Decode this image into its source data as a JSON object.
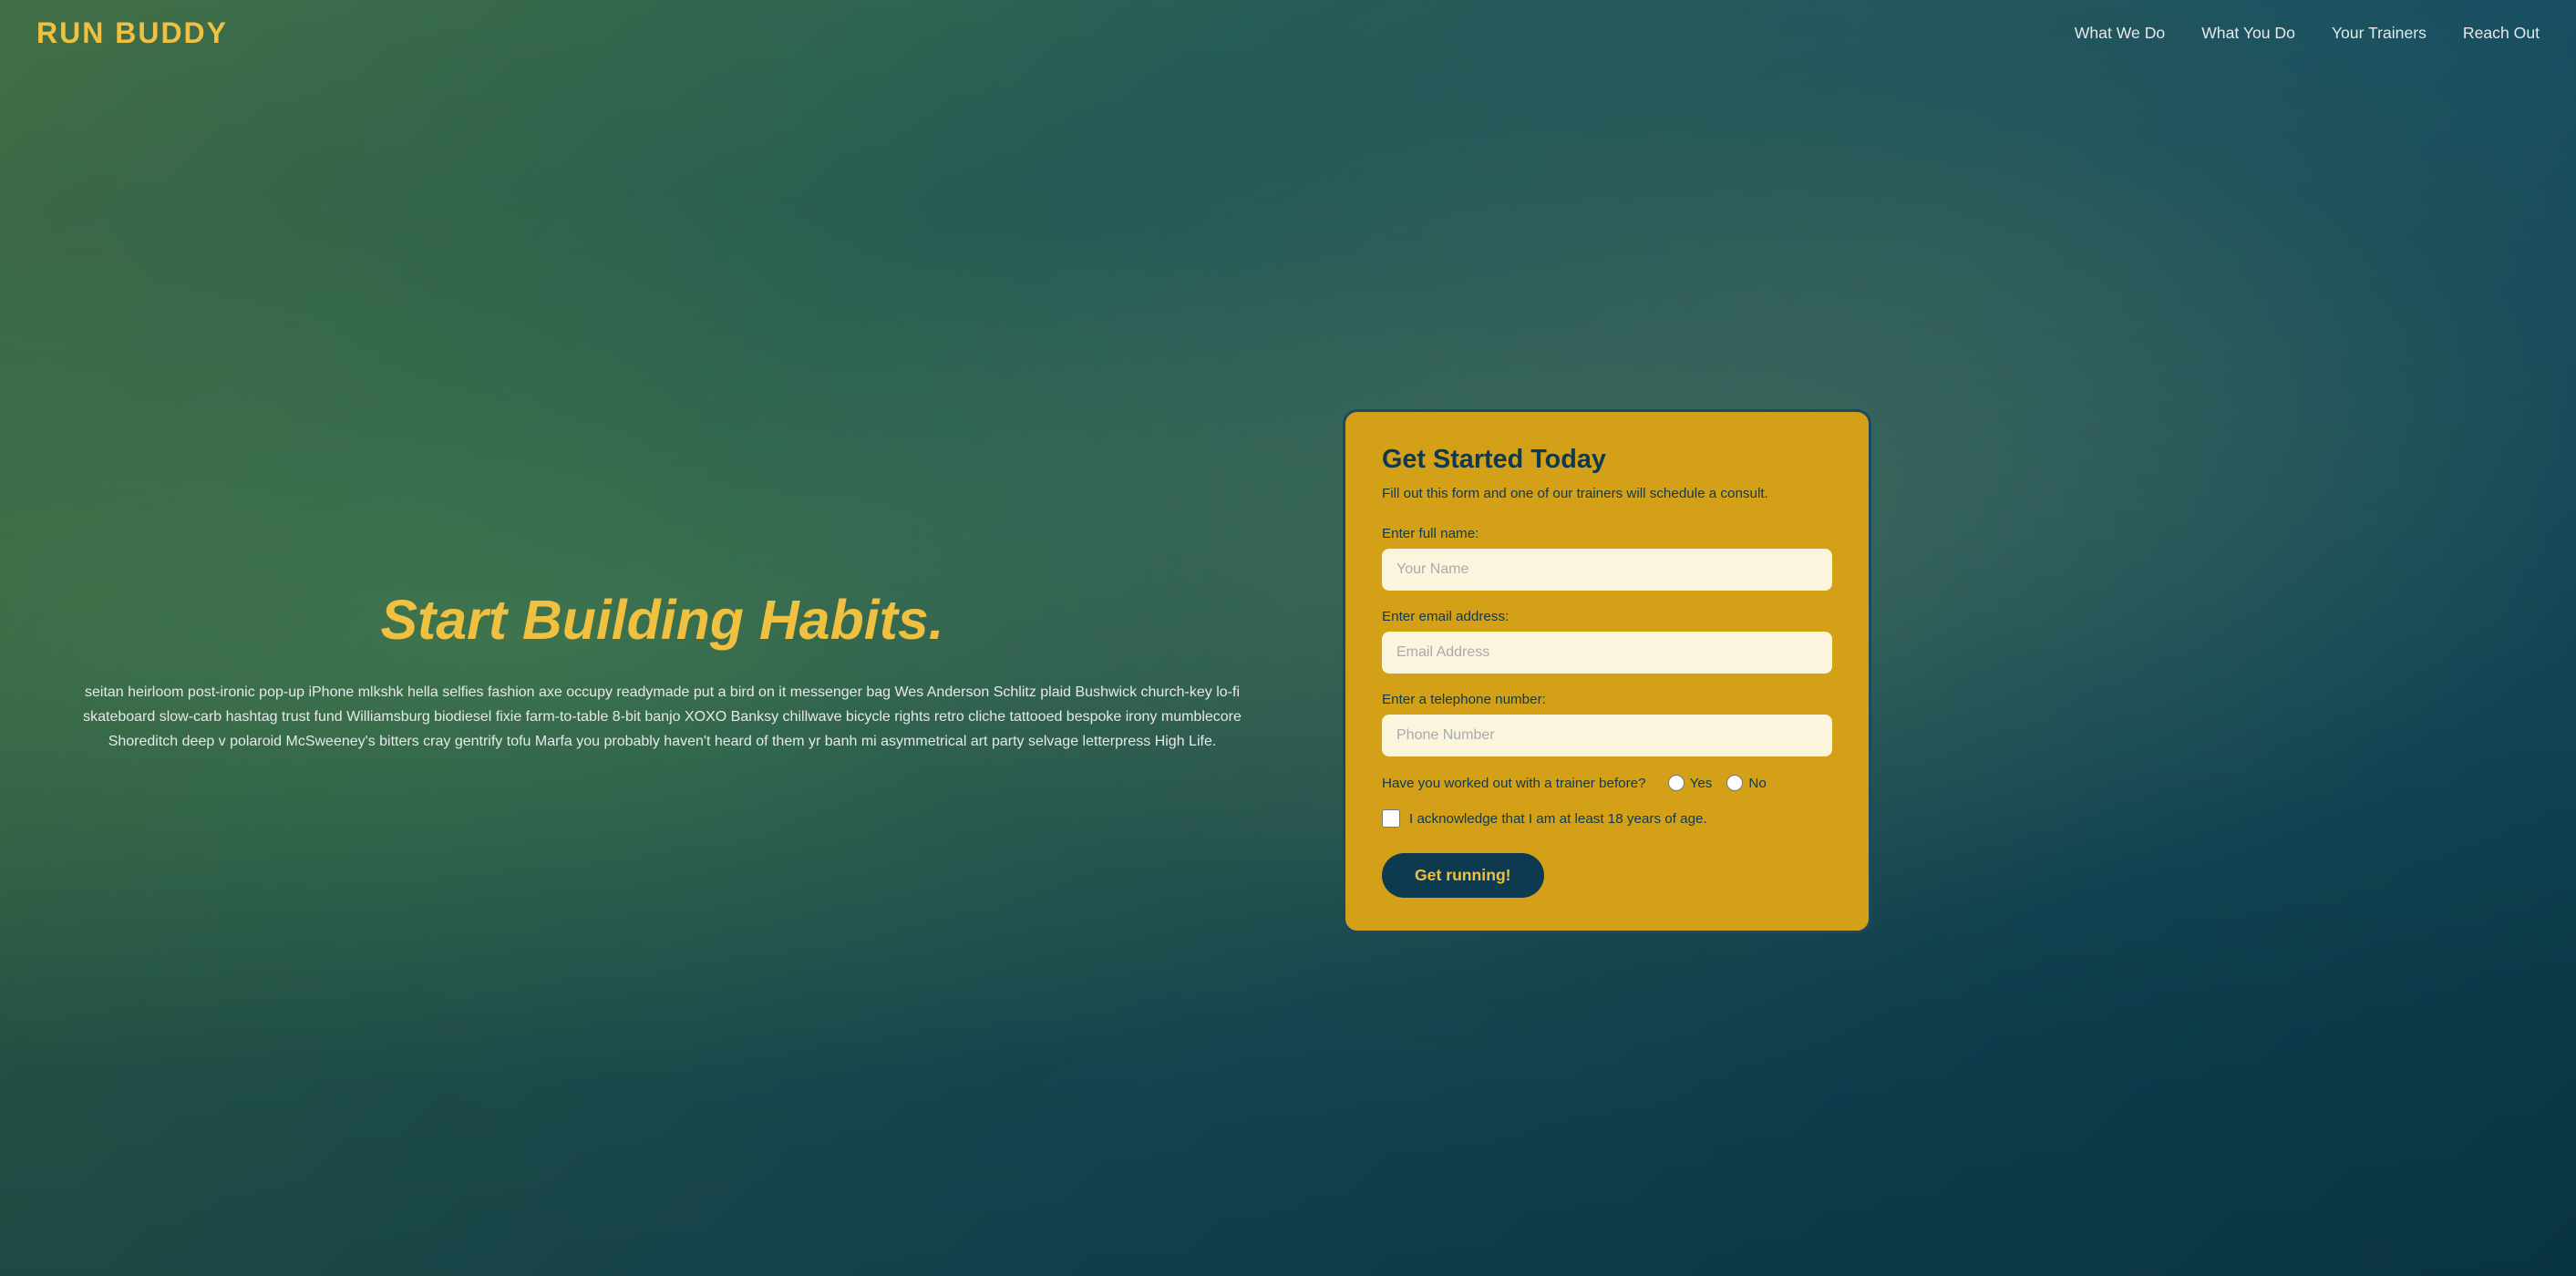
{
  "nav": {
    "logo": "RUN BUDDY",
    "links": [
      {
        "label": "What We Do",
        "href": "#what-we-do"
      },
      {
        "label": "What You Do",
        "href": "#what-you-do"
      },
      {
        "label": "Your Trainers",
        "href": "#your-trainers"
      },
      {
        "label": "Reach Out",
        "href": "#reach-out"
      }
    ]
  },
  "hero": {
    "headline": "Start Building Habits.",
    "body": "seitan heirloom post-ironic pop-up iPhone mlkshk hella selfies fashion axe occupy readymade put a bird on it messenger bag Wes Anderson Schlitz plaid Bushwick church-key lo-fi skateboard slow-carb hashtag trust fund Williamsburg biodiesel fixie farm-to-table 8-bit banjo XOXO Banksy chillwave bicycle rights retro cliche tattooed bespoke irony mumblecore Shoreditch deep v polaroid McSweeney's bitters cray gentrify tofu Marfa you probably haven't heard of them yr banh mi asymmetrical art party selvage letterpress High Life."
  },
  "form": {
    "title": "Get Started Today",
    "subtitle": "Fill out this form and one of our trainers will schedule a consult.",
    "fields": {
      "name": {
        "label": "Enter full name:",
        "placeholder": "Your Name"
      },
      "email": {
        "label": "Enter email address:",
        "placeholder": "Email Address"
      },
      "phone": {
        "label": "Enter a telephone number:",
        "placeholder": "Phone Number"
      }
    },
    "radio": {
      "question": "Have you worked out with a trainer before?",
      "options": [
        "Yes",
        "No"
      ]
    },
    "checkbox": {
      "label": "I acknowledge that I am at least 18 years of age."
    },
    "submit": "Get running!"
  }
}
